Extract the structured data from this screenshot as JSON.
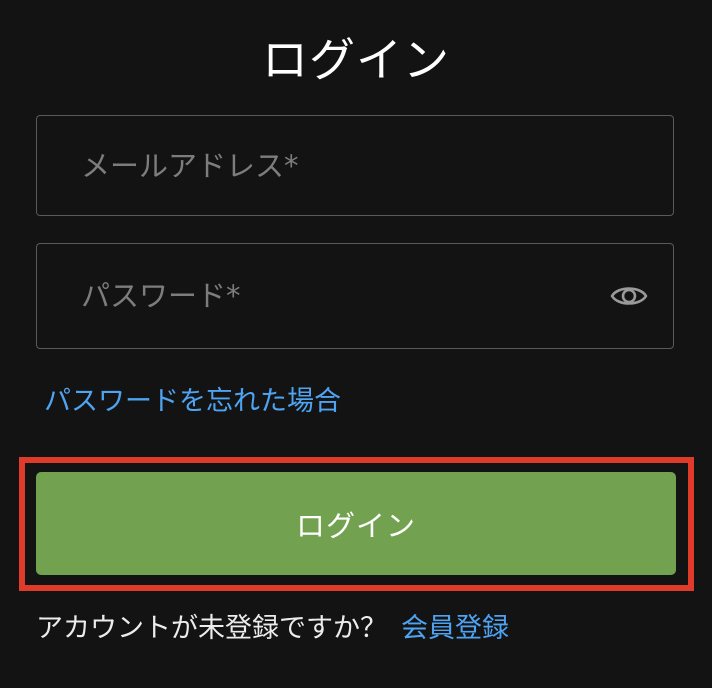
{
  "page": {
    "title": "ログイン"
  },
  "form": {
    "email": {
      "value": "",
      "placeholder": "メールアドレス*"
    },
    "password": {
      "value": "",
      "placeholder": "パスワード*",
      "toggle_icon": "eye-icon"
    },
    "forgot_link": "パスワードを忘れた場合",
    "submit_label": "ログイン",
    "highlight_color": "#e03a2a",
    "button_color": "#72a250",
    "link_color": "#4ea3f2"
  },
  "signup": {
    "prompt": "アカウントが未登録ですか？",
    "link": "会員登録"
  }
}
